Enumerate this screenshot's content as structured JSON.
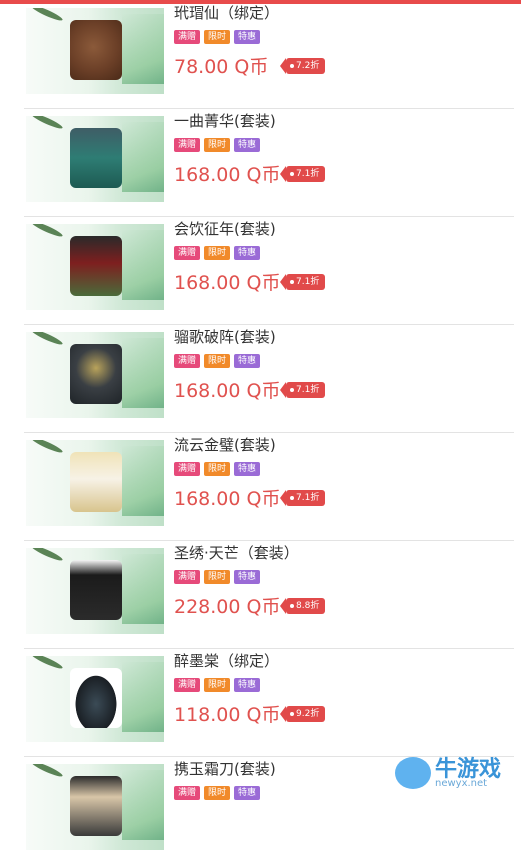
{
  "tag_labels": [
    "满赠",
    "限时",
    "特惠"
  ],
  "colors": {
    "tag_pink": "#e64a7a",
    "tag_orange": "#f18a2a",
    "tag_purple": "#9a6bd6",
    "price": "#e0524f"
  },
  "items": [
    {
      "name": "玳瑁仙（绑定）",
      "price": "78.00 Q币",
      "discount": "7.2折",
      "icon": "coin-ornament-image"
    },
    {
      "name": "一曲菁华(套装)",
      "price": "168.00 Q币",
      "discount": "7.1折",
      "icon": "green-armor-image"
    },
    {
      "name": "会饮征年(套装)",
      "price": "168.00 Q币",
      "discount": "7.1折",
      "icon": "red-robe-image"
    },
    {
      "name": "骝歌破阵(套装)",
      "price": "168.00 Q币",
      "discount": "7.1折",
      "icon": "dark-armor-image"
    },
    {
      "name": "流云金璧(套装)",
      "price": "168.00 Q币",
      "discount": "7.1折",
      "icon": "white-gold-robe-image"
    },
    {
      "name": "圣绣·天芒（套装）",
      "price": "228.00 Q币",
      "discount": "8.8折",
      "icon": "black-warrior-image"
    },
    {
      "name": "醉墨棠（绑定）",
      "price": "118.00 Q币",
      "discount": "9.2折",
      "icon": "black-scarf-image"
    },
    {
      "name": "携玉霜刀(套装)",
      "price": "",
      "discount": "",
      "icon": "warrior-with-hat-image"
    }
  ],
  "watermark": {
    "text": "牛游戏",
    "url": "newyx.net"
  }
}
